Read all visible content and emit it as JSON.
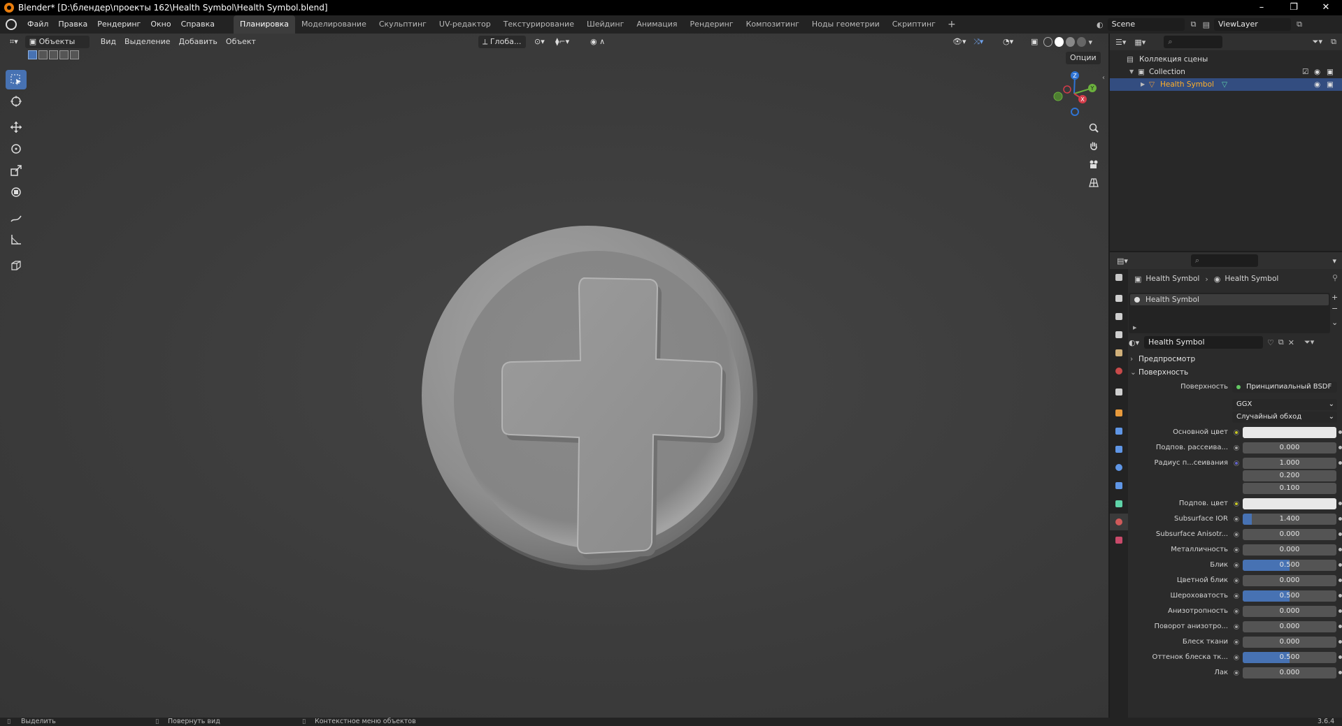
{
  "titlebar": {
    "title": "Blender* [D:\\блендер\\проекты 162\\Health Symbol\\Health Symbol.blend]"
  },
  "menu": [
    "Файл",
    "Правка",
    "Рендеринг",
    "Окно",
    "Справка"
  ],
  "workspaces": [
    "Планировка",
    "Моделирование",
    "Скульптинг",
    "UV-редактор",
    "Текстурирование",
    "Шейдинг",
    "Анимация",
    "Рендеринг",
    "Композитинг",
    "Ноды геометрии",
    "Скриптинг"
  ],
  "active_workspace": "Планировка",
  "scene": {
    "scene_name": "Scene",
    "view_layer": "ViewLayer"
  },
  "viewport_header": {
    "mode": "Объекты",
    "menus": [
      "Вид",
      "Выделение",
      "Добавить",
      "Объект"
    ],
    "transform_orientation": "Глоба...",
    "options": "Опции"
  },
  "tools": [
    "select-box-icon",
    "cursor-icon",
    "move-icon",
    "rotate-icon",
    "scale-icon",
    "transform-icon",
    "annotate-icon",
    "measure-icon",
    "add-cube-icon"
  ],
  "gizmo": {
    "z": "Z",
    "y": "Y",
    "x": "X"
  },
  "outliner": {
    "root": "Коллекция сцены",
    "collection": "Collection",
    "object": "Health Symbol"
  },
  "properties": {
    "breadcrumb_object": "Health Symbol",
    "breadcrumb_material": "Health Symbol",
    "material_slot": "Health Symbol",
    "material_name": "Health Symbol",
    "preview_section": "Предпросмотр",
    "surface_section": "Поверхность",
    "surface_label": "Поверхность",
    "surface_value": "Принципиальный BSDF",
    "distribution": "GGX",
    "subsurface_method": "Случайный обход",
    "fields": [
      {
        "label": "Основной цвет",
        "type": "color",
        "value": "",
        "dot": "yellow"
      },
      {
        "label": "Подпов. рассеива...",
        "type": "num",
        "value": "0.000",
        "dot": "gray",
        "fill": 0
      },
      {
        "label": "Радиус п...сеивания",
        "type": "num",
        "value": "1.000",
        "dot": "blue",
        "fill": 0
      },
      {
        "label": "",
        "type": "num",
        "value": "0.200",
        "dot": "",
        "fill": 0
      },
      {
        "label": "",
        "type": "num",
        "value": "0.100",
        "dot": "",
        "fill": 0
      },
      {
        "label": "Подпов. цвет",
        "type": "color",
        "value": "",
        "dot": "yellow"
      },
      {
        "label": "Subsurface IOR",
        "type": "num",
        "value": "1.400",
        "dot": "gray",
        "fill": 0.1
      },
      {
        "label": "Subsurface Anisotr...",
        "type": "num",
        "value": "0.000",
        "dot": "gray",
        "fill": 0
      },
      {
        "label": "Металличность",
        "type": "num",
        "value": "0.000",
        "dot": "gray",
        "fill": 0
      },
      {
        "label": "Блик",
        "type": "num",
        "value": "0.500",
        "dot": "gray",
        "fill": 0.5
      },
      {
        "label": "Цветной блик",
        "type": "num",
        "value": "0.000",
        "dot": "gray",
        "fill": 0
      },
      {
        "label": "Шероховатость",
        "type": "num",
        "value": "0.500",
        "dot": "gray",
        "fill": 0.5
      },
      {
        "label": "Анизотропность",
        "type": "num",
        "value": "0.000",
        "dot": "gray",
        "fill": 0
      },
      {
        "label": "Поворот анизотро...",
        "type": "num",
        "value": "0.000",
        "dot": "gray",
        "fill": 0
      },
      {
        "label": "Блеск ткани",
        "type": "num",
        "value": "0.000",
        "dot": "gray",
        "fill": 0
      },
      {
        "label": "Оттенок блеска тк...",
        "type": "num",
        "value": "0.500",
        "dot": "gray",
        "fill": 0.5
      },
      {
        "label": "Лак",
        "type": "num",
        "value": "0.000",
        "dot": "gray",
        "fill": 0
      }
    ]
  },
  "statusbar": {
    "select": "Выделить",
    "rotate": "Повернуть вид",
    "context": "Контекстное меню объектов",
    "version": "3.6.4"
  },
  "colors": {
    "accent": "#4772b3",
    "selection": "#334d80",
    "viewport_bg": "#3d3d3d"
  }
}
